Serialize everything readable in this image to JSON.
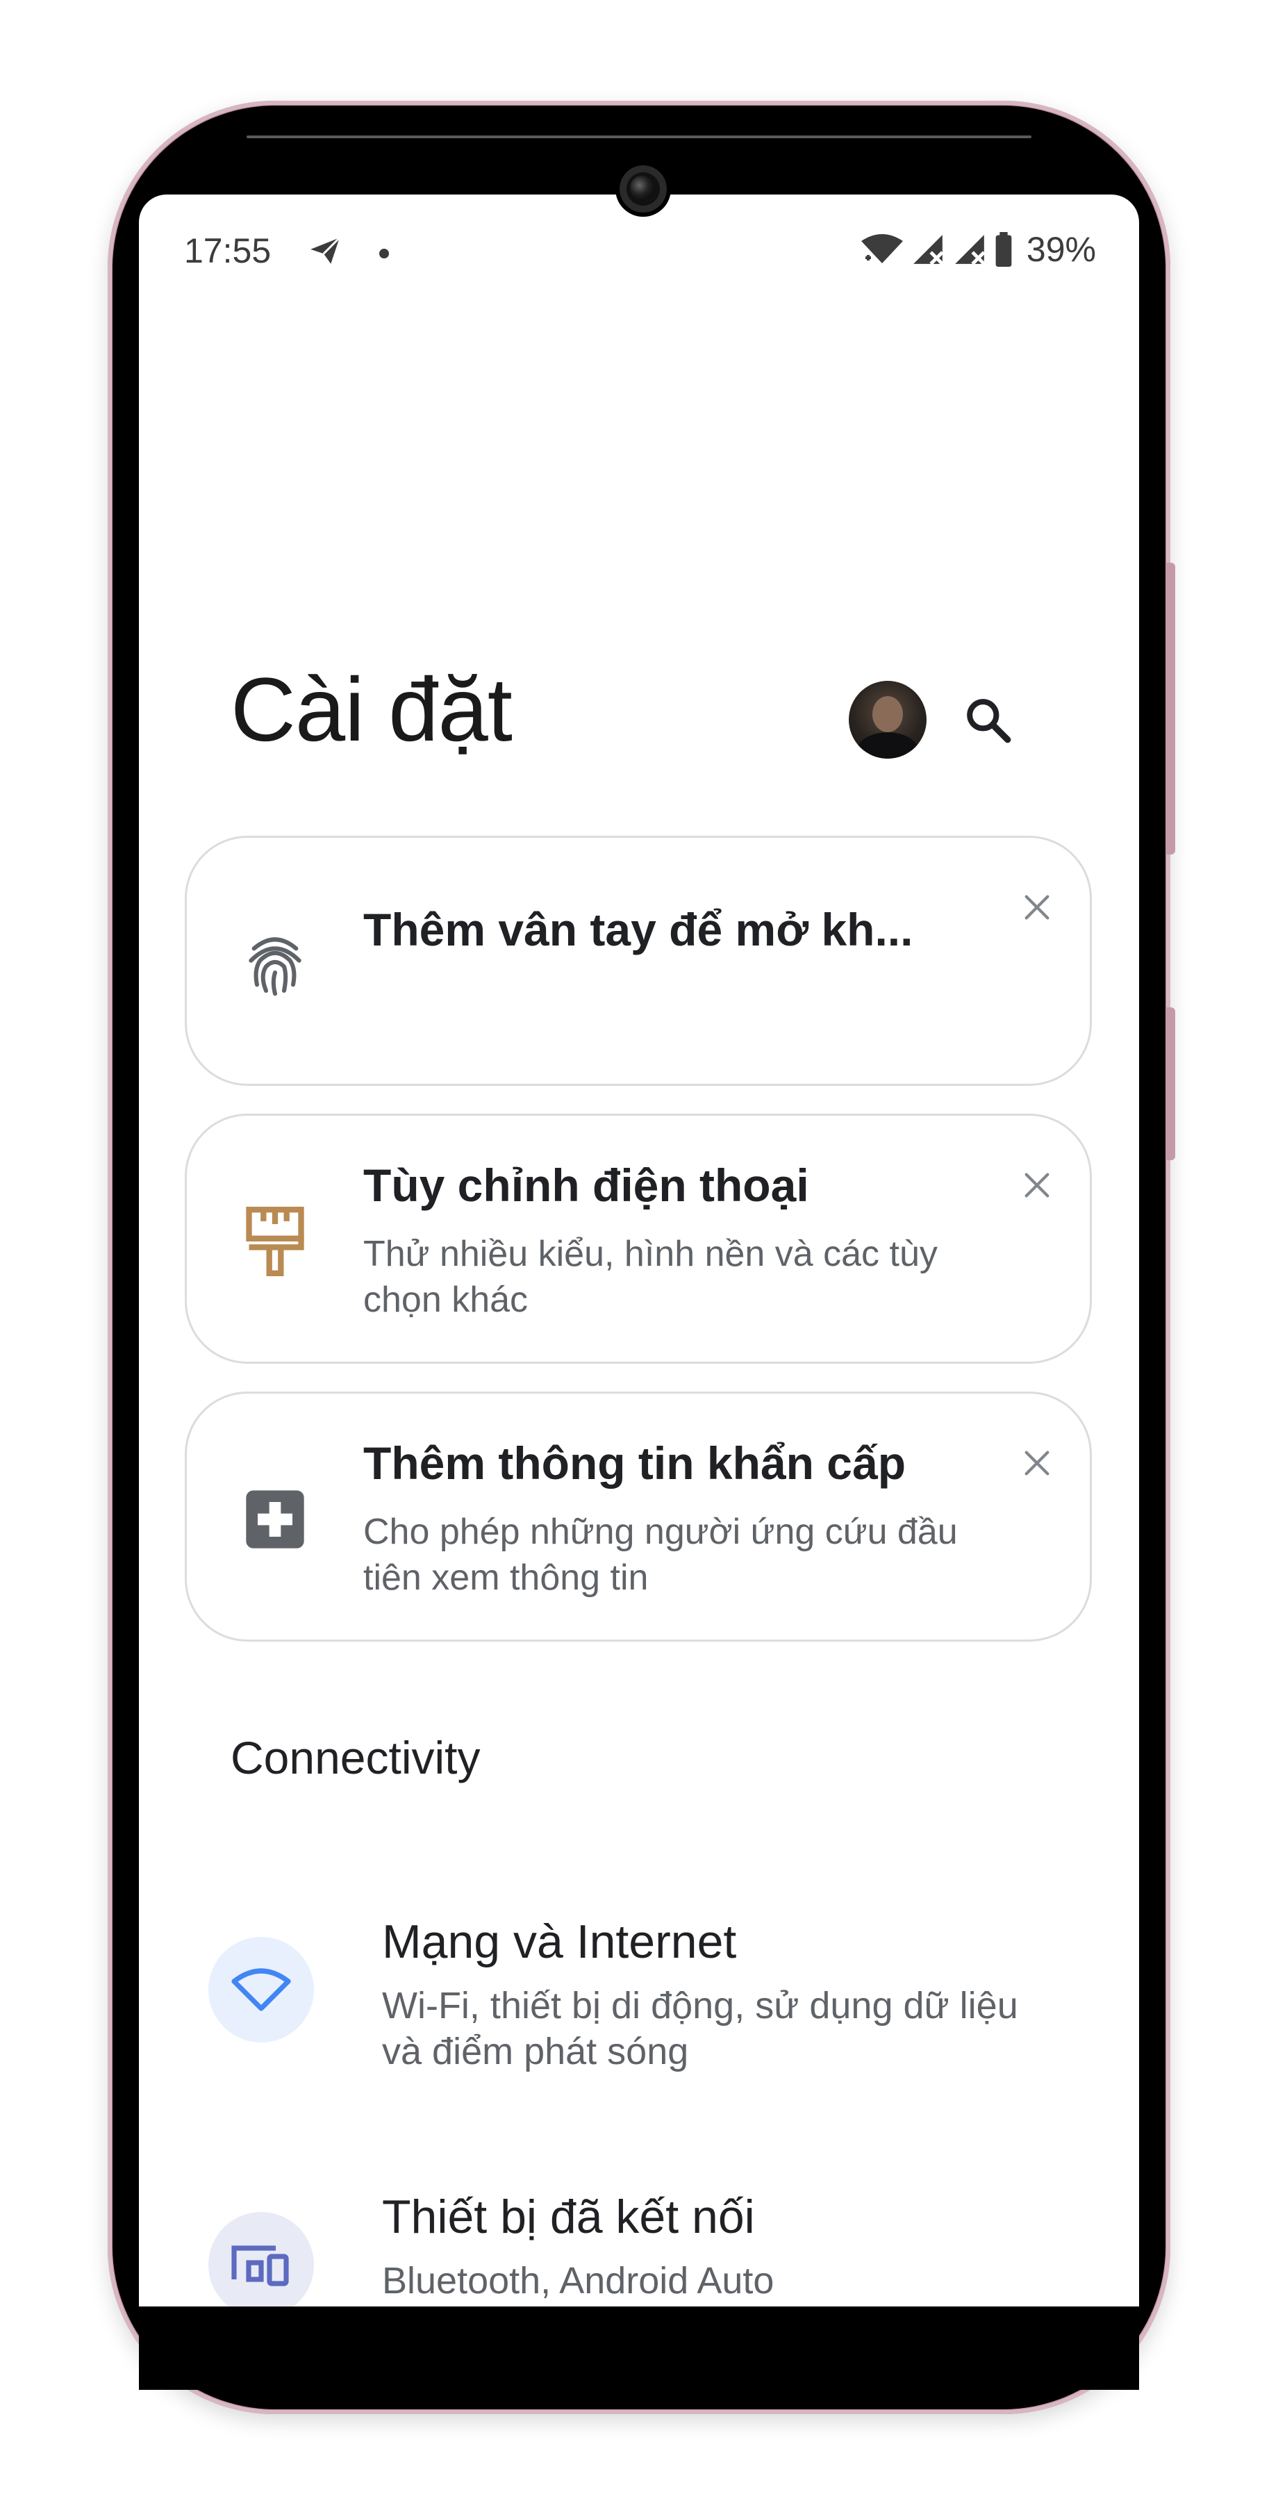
{
  "status_bar": {
    "time": "17:55",
    "battery": "39%"
  },
  "header": {
    "title": "Cài đặt"
  },
  "suggestions": [
    {
      "title": "Thêm vân tay để mở kh...",
      "description": "",
      "icon": "fingerprint-icon",
      "icon_color": "#5f6368"
    },
    {
      "title": "Tùy chỉnh điện thoại",
      "description": "Thử nhiều kiểu, hình nền và các tùy chọn khác",
      "icon": "paintbrush-icon",
      "icon_color": "#b98a52"
    },
    {
      "title": "Thêm thông tin khẩn cấp",
      "description": "Cho phép những người ứng cứu đầu tiên xem thông tin",
      "icon": "medical-cross-icon",
      "icon_color": "#5f6368"
    }
  ],
  "section": {
    "title": "Connectivity"
  },
  "settings_items": [
    {
      "title": "Mạng và Internet",
      "description": "Wi-Fi, thiết bị di động, sử dụng dữ liệu và điểm phát sóng",
      "icon": "wifi-icon",
      "icon_bg": "#e8f0fe",
      "icon_color": "#4285f4"
    },
    {
      "title": "Thiết bị đã kết nối",
      "description": "Bluetooth, Android Auto",
      "icon": "connected-devices-icon",
      "icon_bg": "#e8eaf6",
      "icon_color": "#5c6bc0"
    }
  ],
  "colors": {
    "frame": "#b98b9b",
    "card_border": "#dadce0",
    "text_primary": "#202124",
    "text_secondary": "#5f6368"
  }
}
